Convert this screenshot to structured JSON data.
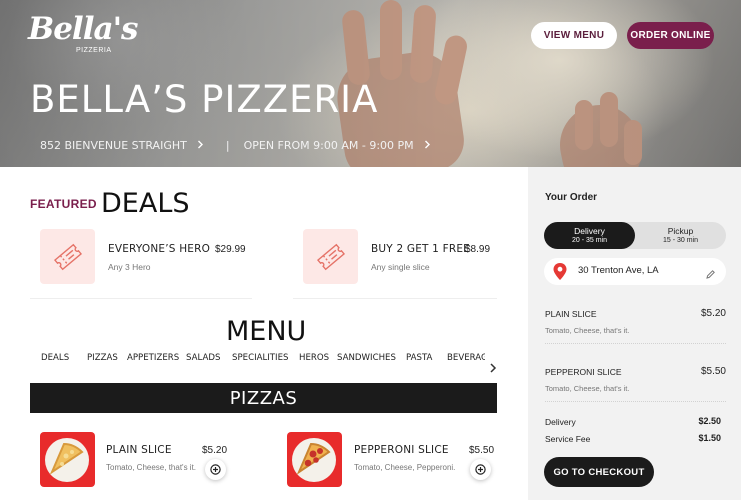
{
  "brand": {
    "logo_script": "Bella's",
    "logo_sub": "PIZZERIA",
    "title": "BELLA’S PIZZERIA",
    "address": "852 BIENVENUE STRAIGHT",
    "hours": "OPEN FROM 9:00 AM - 9:00 PM",
    "separator": "|"
  },
  "header": {
    "view_menu": "VIEW MENU",
    "order_online": "ORDER ONLINE"
  },
  "featured": {
    "tag": "FEATURED",
    "heading": "DEALS",
    "deals": [
      {
        "name": "EVERYONE’S HERO",
        "price": "$29.99",
        "sub": "Any 3 Hero",
        "icon": "ticket-icon"
      },
      {
        "name": "BUY 2 GET 1 FREE",
        "price": "$8.99",
        "sub": "Any single slice",
        "icon": "ticket-icon"
      }
    ]
  },
  "menu": {
    "heading": "MENU",
    "tabs": [
      "DEALS",
      "PIZZAS",
      "APPETIZERS",
      "SALADS",
      "SPECIALITIES",
      "HEROS",
      "SANDWICHES",
      "PASTA",
      "BEVERAGES"
    ],
    "section_title": "PIZZAS",
    "items": [
      {
        "name": "PLAIN SLICE",
        "price": "$5.20",
        "desc": "Tomato, Cheese, that's it."
      },
      {
        "name": "PEPPERONI SLICE",
        "price": "$5.50",
        "desc": "Tomato, Cheese, Pepperoni."
      }
    ]
  },
  "order": {
    "title": "Your Order",
    "delivery": {
      "label": "Delivery",
      "time": "20 - 35 min"
    },
    "pickup": {
      "label": "Pickup",
      "time": "15 - 30 min"
    },
    "address": "30 Trenton Ave, LA",
    "lines": [
      {
        "name": "PLAIN SLICE",
        "price": "$5.20",
        "desc": "Tomato, Cheese, that's it."
      },
      {
        "name": "PEPPERONI SLICE",
        "price": "$5.50",
        "desc": "Tomato, Cheese, that's it."
      }
    ],
    "fees": [
      {
        "label": "Delivery",
        "value": "$2.50"
      },
      {
        "label": "Service Fee",
        "value": "$1.50"
      }
    ],
    "checkout": "GO TO CHECKOUT"
  },
  "colors": {
    "accent": "#7a1f4c",
    "dark": "#1b1b1b",
    "pin": "#e53935",
    "deal_icon_bg": "#fde8e6",
    "deal_icon_stroke": "#e57368"
  }
}
